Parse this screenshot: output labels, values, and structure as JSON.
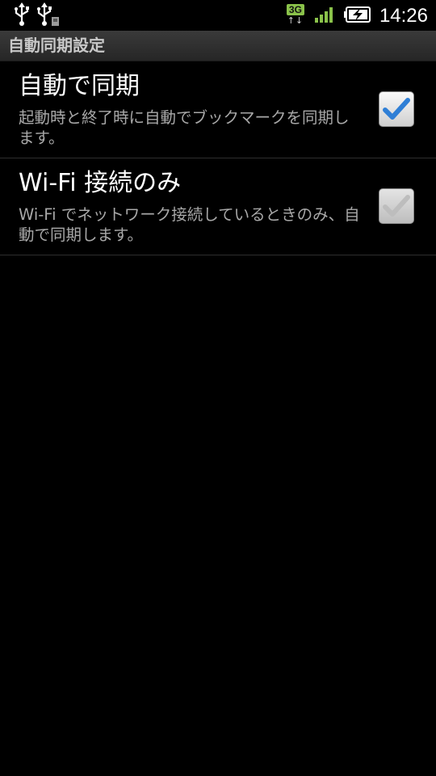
{
  "status_bar": {
    "icons_left": [
      "usb-icon",
      "usb-debug-icon"
    ],
    "network_type": "3G",
    "network_arrows": "↑↓",
    "signal_icon": "signal-bars-icon",
    "battery_icon": "battery-charging-icon",
    "time": "14:26"
  },
  "header": {
    "title": "自動同期設定"
  },
  "preferences": [
    {
      "title": "自動で同期",
      "summary": "起動時と終了時に自動でブックマークを同期します。",
      "checked": true,
      "enabled": true,
      "check_color": "#2f7fd6"
    },
    {
      "title": "Wi-Fi 接続のみ",
      "summary": "Wi-Fi でネットワーク接続しているときのみ、自動で同期します。",
      "checked": true,
      "enabled": false,
      "check_color": "#bdbdbd"
    }
  ],
  "colors": {
    "background": "#000000",
    "title_text": "#c8c8c8",
    "summary_text": "#a8a8a8",
    "network_badge": "#8ac24a"
  }
}
